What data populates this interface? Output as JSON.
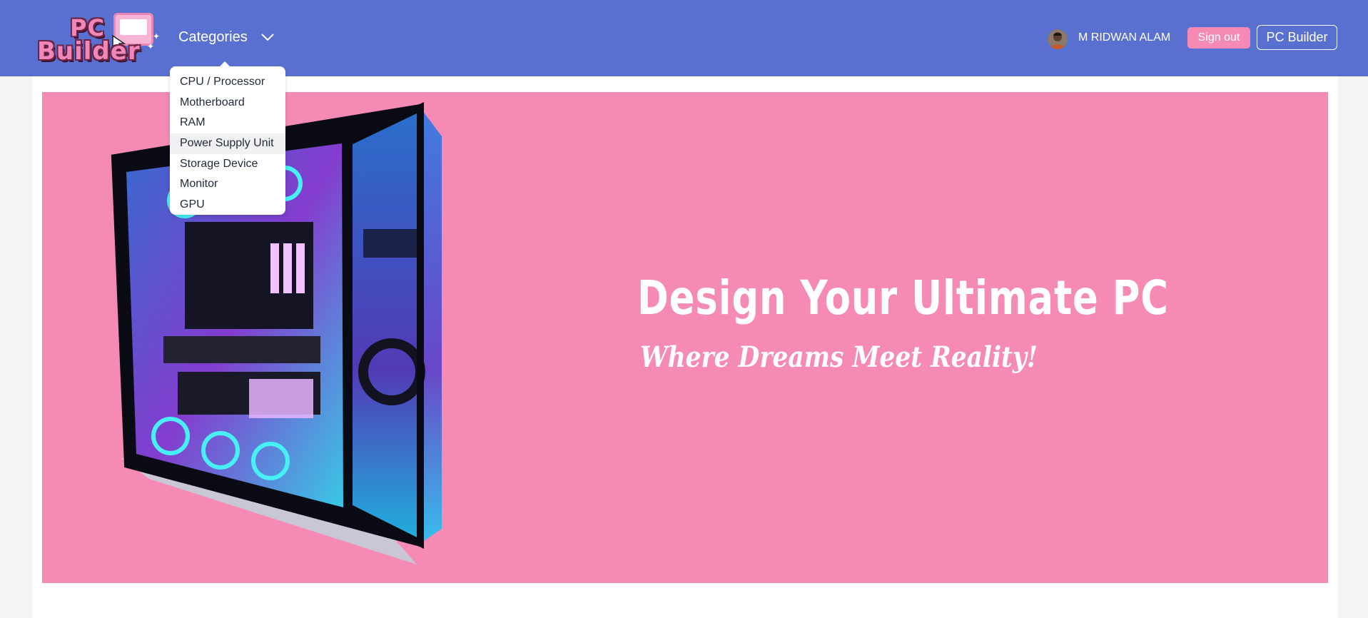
{
  "brand": {
    "logo_line1": "PC",
    "logo_line2": "Builder"
  },
  "nav": {
    "categories_label": "Categories",
    "dropdown_open": true,
    "categories": [
      {
        "label": "CPU / Processor"
      },
      {
        "label": "Motherboard"
      },
      {
        "label": "RAM"
      },
      {
        "label": "Power Supply Unit",
        "hovered": true
      },
      {
        "label": "Storage Device"
      },
      {
        "label": "Monitor"
      },
      {
        "label": "GPU"
      }
    ]
  },
  "user": {
    "name": "M RIDWAN ALAM",
    "sign_out_label": "Sign out",
    "pc_builder_label": "PC Builder"
  },
  "hero": {
    "title": "Design Your Ultimate PC",
    "subtitle": "Where Dreams Meet Reality!"
  },
  "colors": {
    "navbar": "#5a70d1",
    "hero_background": "#f58ab5",
    "accent_pink": "#f58ab5",
    "page_background": "#f4f4f5",
    "white": "#ffffff"
  },
  "icons": {
    "categories_toggle": "chevron-down-icon",
    "avatar": "user-avatar"
  }
}
